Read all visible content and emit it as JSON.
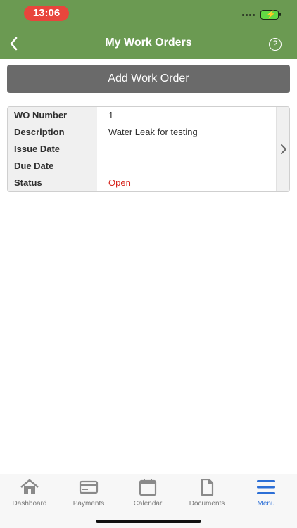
{
  "status_bar": {
    "time": "13:06"
  },
  "header": {
    "title": "My Work Orders"
  },
  "actions": {
    "add_label": "Add Work Order"
  },
  "work_order": {
    "labels": [
      "WO Number",
      "Description",
      "Issue Date",
      "Due Date",
      "Status"
    ],
    "values": [
      "1",
      "Water Leak for testing",
      "",
      "",
      "Open"
    ]
  },
  "nav": {
    "items": [
      {
        "label": "Dashboard",
        "icon": "house-icon"
      },
      {
        "label": "Payments",
        "icon": "card-icon"
      },
      {
        "label": "Calendar",
        "icon": "calendar-icon"
      },
      {
        "label": "Documents",
        "icon": "document-icon"
      },
      {
        "label": "Menu",
        "icon": "menu-icon"
      }
    ],
    "active": "Menu"
  },
  "colors": {
    "header": "#6b9a52",
    "status_open": "#d6231b",
    "active_nav": "#2c6fd6",
    "button": "#6a6a6a"
  }
}
